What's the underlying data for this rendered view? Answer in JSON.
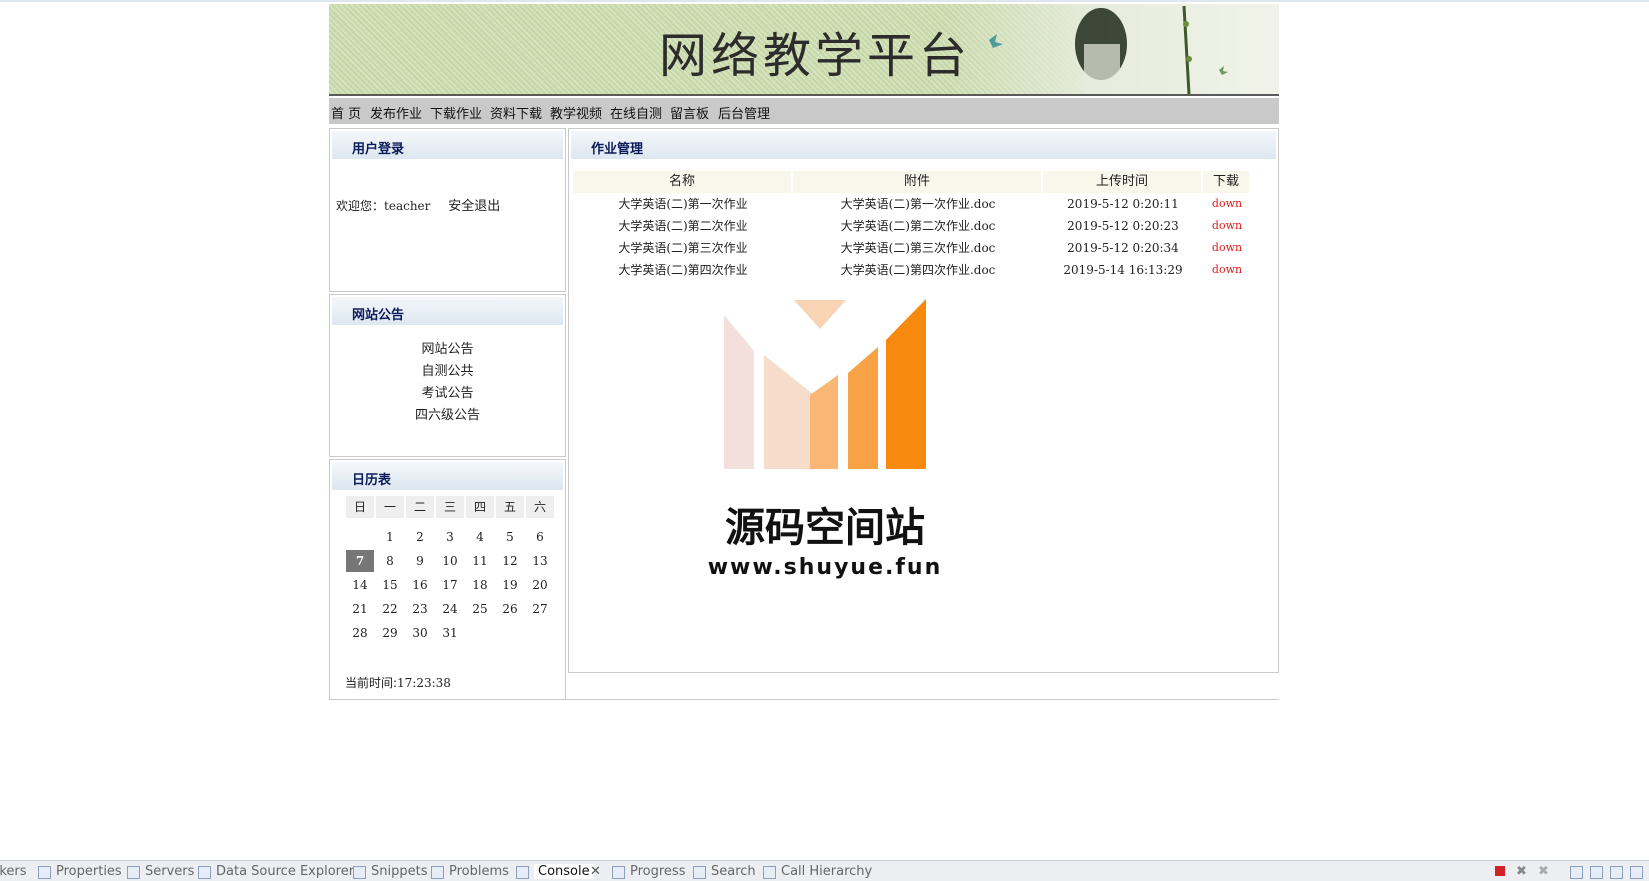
{
  "site": {
    "title": "网络教学平台"
  },
  "nav": [
    "首 页",
    "发布作业",
    "下载作业",
    "资料下载",
    "教学视频",
    "在线自测",
    "留言板",
    "后台管理"
  ],
  "login": {
    "header": "用户登录",
    "welcome": "欢迎您：",
    "user": "teacher",
    "logout": "安全退出"
  },
  "notice": {
    "header": "网站公告",
    "items": [
      "网站公告",
      "自测公共",
      "考试公告",
      "四六级公告"
    ]
  },
  "calendar": {
    "header": "日历表",
    "weekdays": [
      "日",
      "一",
      "二",
      "三",
      "四",
      "五",
      "六"
    ],
    "weeks": [
      [
        "",
        "1",
        "2",
        "3",
        "4",
        "5",
        "6"
      ],
      [
        "7",
        "8",
        "9",
        "10",
        "11",
        "12",
        "13"
      ],
      [
        "14",
        "15",
        "16",
        "17",
        "18",
        "19",
        "20"
      ],
      [
        "21",
        "22",
        "23",
        "24",
        "25",
        "26",
        "27"
      ],
      [
        "28",
        "29",
        "30",
        "31",
        "",
        "",
        ""
      ]
    ],
    "today": "7",
    "time_label": "当前时间:",
    "time": "17:23:38"
  },
  "homework": {
    "header": "作业管理",
    "columns": [
      "名称",
      "附件",
      "上传时间",
      "下载"
    ],
    "rows": [
      [
        "大学英语(二)第一次作业",
        "大学英语(二)第一次作业.doc",
        "2019-5-12 0:20:11",
        "down"
      ],
      [
        "大学英语(二)第二次作业",
        "大学英语(二)第二次作业.doc",
        "2019-5-12 0:20:23",
        "down"
      ],
      [
        "大学英语(二)第三次作业",
        "大学英语(二)第三次作业.doc",
        "2019-5-12 0:20:34",
        "down"
      ],
      [
        "大学英语(二)第四次作业",
        "大学英语(二)第四次作业.doc",
        "2019-5-14 16:13:29",
        "down"
      ]
    ]
  },
  "watermark": {
    "name": "源码空间站",
    "url": "www.shuyue.fun"
  },
  "ide_tabs": [
    "rkers",
    "Properties",
    "Servers",
    "Data Source Explorer",
    "Snippets",
    "Problems",
    "Console",
    "Progress",
    "Search",
    "Call Hierarchy"
  ],
  "colors": {
    "nav_bg": "#c9c9c9",
    "header_text": "#0c1c5a",
    "down_link": "#e01818",
    "watermark_orange": "#f7890f"
  }
}
